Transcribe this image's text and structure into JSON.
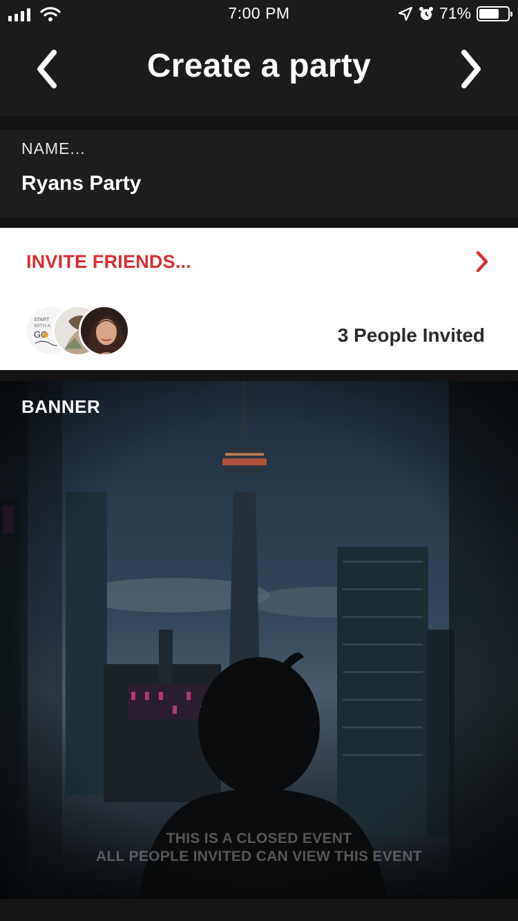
{
  "status_bar": {
    "time": "7:00 PM",
    "battery_percent": "71%",
    "battery_level": 0.71,
    "icons": [
      "signal-icon",
      "wifi-icon",
      "location-icon",
      "alarm-icon",
      "battery-icon"
    ]
  },
  "nav": {
    "title": "Create a party",
    "back_icon": "chevron-left-icon",
    "next_icon": "chevron-right-icon"
  },
  "name_section": {
    "label": "NAME...",
    "value": "Ryans Party"
  },
  "invite_section": {
    "label": "INVITE FRIENDS...",
    "count_text": "3 People Invited",
    "avatar_count": 3,
    "accent_color": "#d62e33"
  },
  "banner": {
    "label": "BANNER",
    "note_line1": "THIS IS A CLOSED EVENT",
    "note_line2": "ALL PEOPLE INVITED CAN VIEW THIS EVENT"
  }
}
